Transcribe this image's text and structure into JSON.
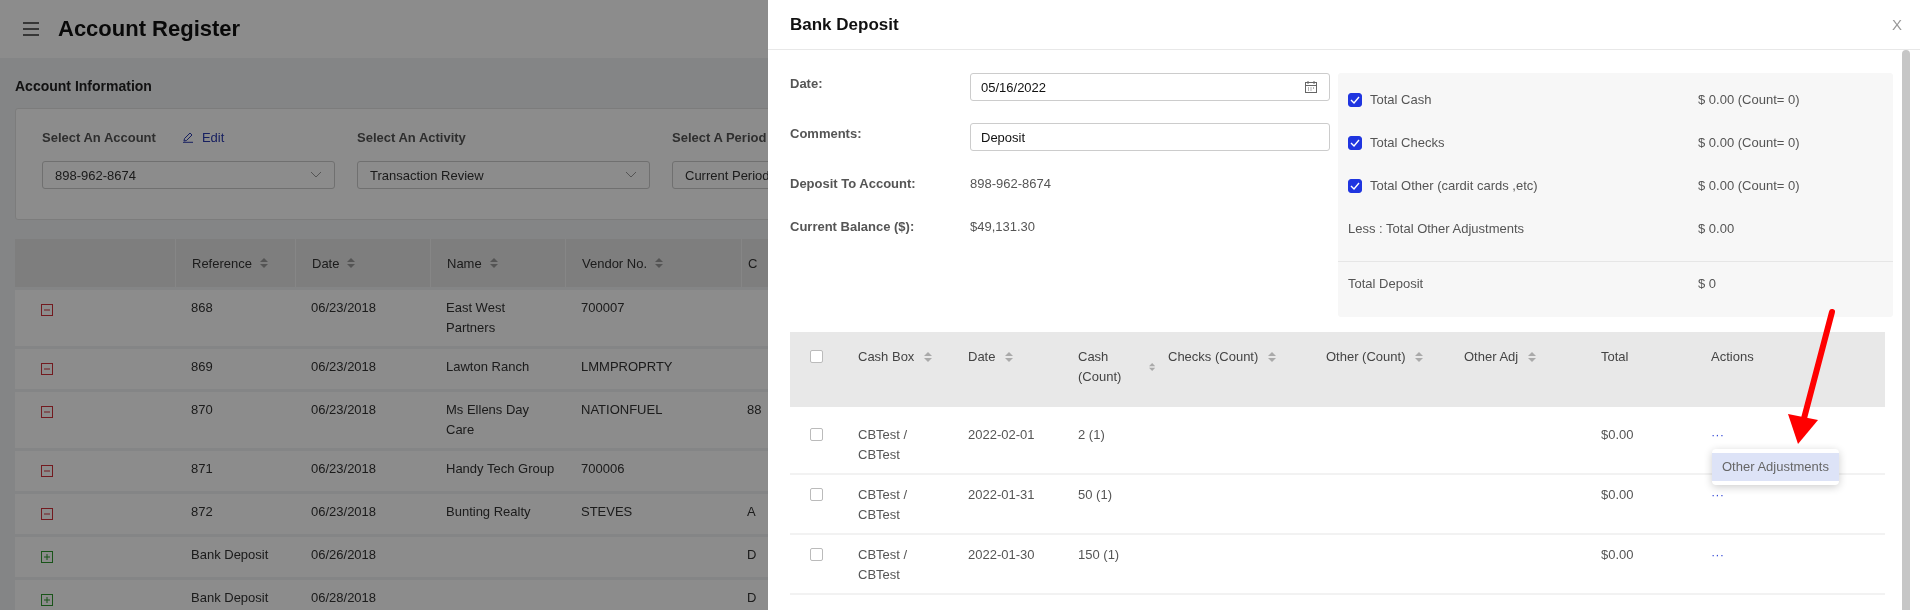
{
  "app": {
    "title": "Account Register"
  },
  "account_information": {
    "heading": "Account Information",
    "filters": [
      {
        "label": "Select An Account",
        "value": "898-962-8674",
        "edit_link": "Edit"
      },
      {
        "label": "Select An Activity",
        "value": "Transaction Review"
      },
      {
        "label": "Select A Period",
        "value": "Current Period"
      }
    ]
  },
  "register_table": {
    "columns": [
      "Reference",
      "Date",
      "Name",
      "Vendor No.",
      "C"
    ],
    "rows": [
      {
        "kind": "withdrawal",
        "cells": [
          "868",
          "06/23/2018",
          "East West Partners",
          "700007",
          ""
        ]
      },
      {
        "kind": "withdrawal",
        "cells": [
          "869",
          "06/23/2018",
          "Lawton Ranch",
          "LMMPROPRTY",
          ""
        ]
      },
      {
        "kind": "withdrawal",
        "cells": [
          "870",
          "06/23/2018",
          "Ms Ellens Day Care",
          "NATIONFUEL",
          "88"
        ]
      },
      {
        "kind": "withdrawal",
        "cells": [
          "871",
          "06/23/2018",
          "Handy Tech Group",
          "700006",
          ""
        ]
      },
      {
        "kind": "withdrawal",
        "cells": [
          "872",
          "06/23/2018",
          "Bunting Realty",
          "STEVES",
          "A"
        ]
      },
      {
        "kind": "deposit",
        "cells": [
          "Bank Deposit",
          "06/26/2018",
          "",
          "",
          "D"
        ]
      },
      {
        "kind": "deposit",
        "cells": [
          "Bank Deposit",
          "06/28/2018",
          "",
          "",
          "D"
        ]
      }
    ]
  },
  "dialog": {
    "title": "Bank Deposit",
    "close": "X",
    "form": [
      {
        "kind": "date",
        "label": "Date:",
        "value": "05/16/2022"
      },
      {
        "kind": "text",
        "label": "Comments:",
        "value": "Deposit"
      },
      {
        "kind": "static",
        "label": "Deposit To Account:",
        "value": "898-962-8674"
      },
      {
        "kind": "static",
        "label": "Current Balance ($):",
        "value": "$49,131.30"
      }
    ],
    "totals": [
      {
        "label": "Total Cash",
        "value": "$ 0.00 (Count= 0)",
        "checked": true
      },
      {
        "label": "Total Checks",
        "value": "$ 0.00 (Count= 0)",
        "checked": true
      },
      {
        "label": "Total Other (cardit cards ,etc)",
        "value": "$ 0.00 (Count= 0)",
        "checked": true
      }
    ],
    "adjustments": {
      "label": "Less : Total Other Adjustments",
      "value": "$ 0.00"
    },
    "total_deposit": {
      "label": "Total Deposit",
      "value": "$ 0"
    },
    "cash_table": {
      "select_all": {
        "checked": false
      },
      "columns": [
        {
          "label": "Cash Box",
          "sortable": true
        },
        {
          "label": "Date",
          "sortable": true
        },
        {
          "label": "Cash (Count)",
          "sortable": true
        },
        {
          "label": "Checks (Count)",
          "sortable": true
        },
        {
          "label": "Other (Count)",
          "sortable": true
        },
        {
          "label": "Other Adj",
          "sortable": true
        },
        {
          "label": "Total",
          "sortable": false
        },
        {
          "label": "Actions",
          "sortable": false
        }
      ],
      "rows": [
        {
          "selected": false,
          "cells": [
            "CBTest / CBTest",
            "2022-02-01",
            "2 (1)",
            "",
            "",
            "",
            "$0.00"
          ],
          "actions": "···",
          "menu": [
            {
              "label": "Other Adjustments",
              "selected": true
            }
          ]
        },
        {
          "selected": false,
          "cells": [
            "CBTest / CBTest",
            "2022-01-31",
            "50 (1)",
            "",
            "",
            "",
            "$0.00"
          ],
          "actions": "···"
        },
        {
          "selected": false,
          "cells": [
            "CBTest / CBTest",
            "2022-01-30",
            "150 (1)",
            "",
            "",
            "",
            "$0.00"
          ],
          "actions": "···"
        }
      ]
    }
  }
}
